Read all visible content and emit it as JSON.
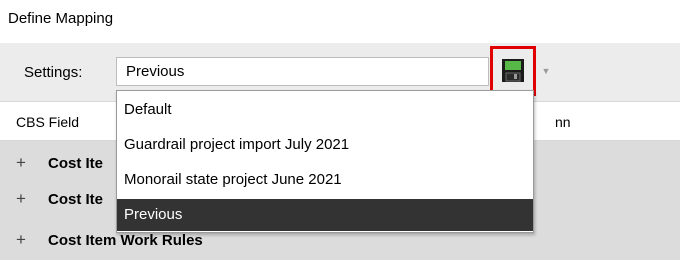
{
  "window": {
    "title": "Define Mapping"
  },
  "settings": {
    "label": "Settings:",
    "selected_value": "Previous",
    "save_icon": "floppy-disk-icon",
    "dropdown_arrow_icon": "chevron-down-icon",
    "options": [
      {
        "label": "Default",
        "selected": false
      },
      {
        "label": "Guardrail project import July 2021",
        "selected": false
      },
      {
        "label": "Monorail state project June 2021",
        "selected": false
      },
      {
        "label": "Previous",
        "selected": true
      }
    ]
  },
  "grid": {
    "columns": [
      "CBS Field",
      "nn"
    ],
    "rows": [
      {
        "expander": "+",
        "label": "Cost Ite"
      },
      {
        "expander": "+",
        "label": "Cost Ite"
      },
      {
        "expander": "+",
        "label": "Cost Item Work Rules"
      }
    ]
  },
  "colors": {
    "highlight_border": "#e00000",
    "selected_item_bg": "#333333",
    "selected_item_text": "#ffffff",
    "grid_body_bg": "#dcdcdc"
  }
}
